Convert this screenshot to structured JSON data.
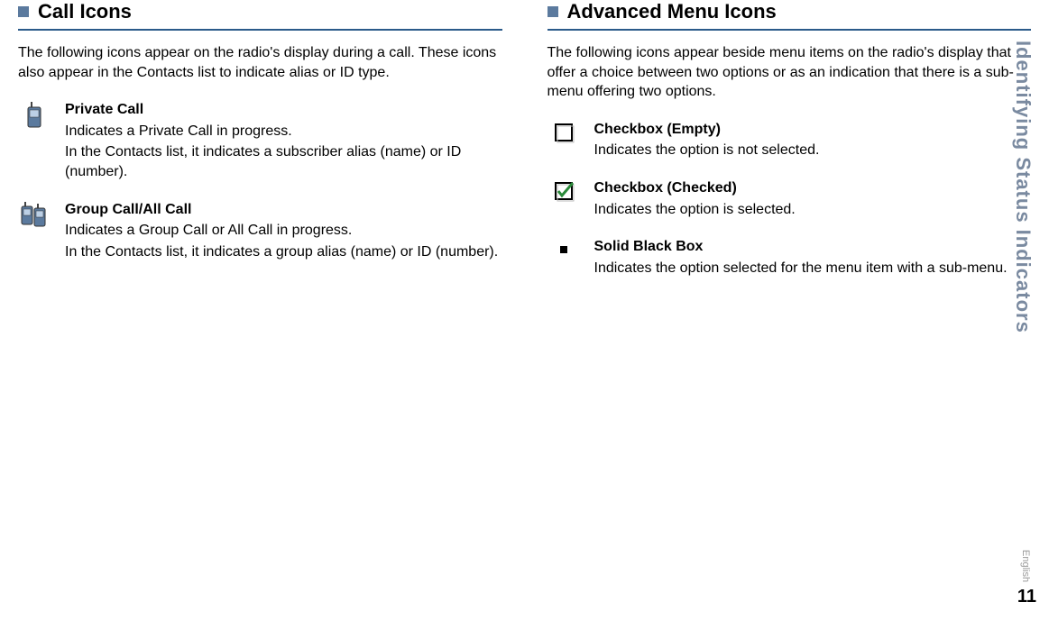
{
  "sideTab": "Identifying Status Indicators",
  "englishLabel": "English",
  "pageNumber": "11",
  "left": {
    "heading": "Call Icons",
    "intro": "The following icons appear on the radio's display during a call. These icons also appear in the Contacts list to indicate alias or ID type.",
    "items": [
      {
        "icon": "private-call-icon",
        "title": "Private Call",
        "desc1": "Indicates a Private Call in progress.",
        "desc2": "In the Contacts list, it indicates a subscriber alias (name) or ID (number)."
      },
      {
        "icon": "group-call-icon",
        "title": "Group Call/All Call",
        "desc1": "Indicates a Group Call or All Call in progress.",
        "desc2": "In the Contacts list, it indicates a group alias (name) or ID (number)."
      }
    ]
  },
  "right": {
    "heading": "Advanced Menu Icons",
    "intro": "The following icons appear beside menu items on the radio's display that offer a choice between two options or as an indication that there is a sub-menu offering two options.",
    "items": [
      {
        "icon": "checkbox-empty-icon",
        "title": "Checkbox (Empty)",
        "desc1": "Indicates the option is not selected.",
        "desc2": ""
      },
      {
        "icon": "checkbox-checked-icon",
        "title": "Checkbox (Checked)",
        "desc1": "Indicates the option is selected.",
        "desc2": ""
      },
      {
        "icon": "solid-black-box-icon",
        "title": "Solid Black Box",
        "desc1": "Indicates the option selected for the menu item with a sub-menu.",
        "desc2": ""
      }
    ]
  }
}
